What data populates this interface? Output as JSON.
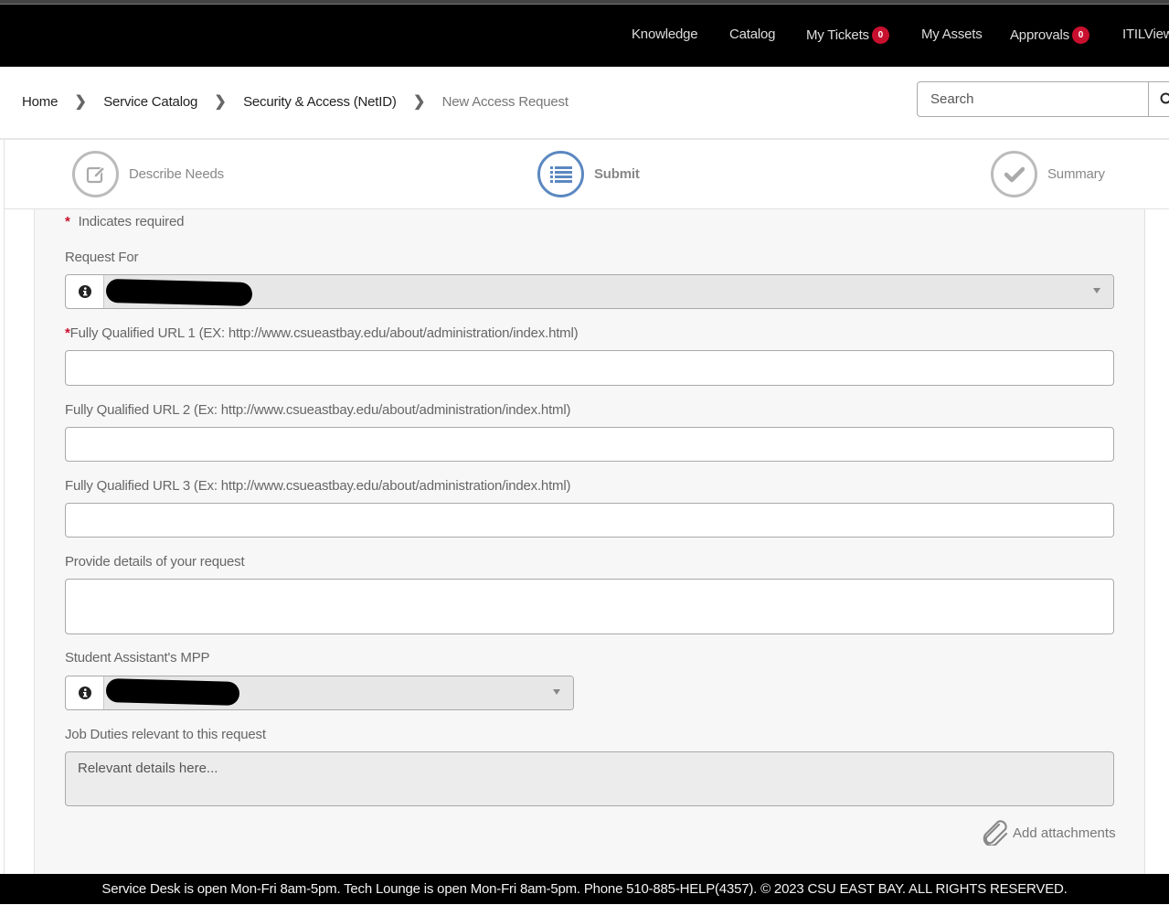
{
  "nav": {
    "items": [
      {
        "label": "Knowledge"
      },
      {
        "label": "Catalog"
      },
      {
        "label": "My Tickets",
        "badge": "0"
      },
      {
        "label": "My Assets"
      },
      {
        "label": "Approvals",
        "badge": "0"
      },
      {
        "label": "ITILView"
      }
    ],
    "badge_color": "#c8102e"
  },
  "breadcrumb": {
    "items": [
      "Home",
      "Service Catalog",
      "Security & Access (NetID)"
    ],
    "current": "New Access Request",
    "separator_icon": "chevron-right-icon"
  },
  "search": {
    "placeholder": "Search",
    "value": "",
    "icon": "search-icon"
  },
  "stepper": {
    "steps": [
      {
        "label": "Describe Needs",
        "icon": "edit-icon",
        "state": "inactive"
      },
      {
        "label": "Submit",
        "icon": "list-icon",
        "state": "active"
      },
      {
        "label": "Summary",
        "icon": "check-icon",
        "state": "inactive"
      }
    ],
    "active_color": "#5b88c0"
  },
  "form": {
    "required_note": "Indicates required",
    "required_marker": "*",
    "request_for": {
      "label": "Request For",
      "value": "[redacted]",
      "icon": "info-icon"
    },
    "url1": {
      "label": "Fully Qualified URL 1 (EX: http://www.csueastbay.edu/about/administration/index.html)",
      "required": true,
      "value": ""
    },
    "url2": {
      "label": "Fully Qualified URL 2 (Ex: http://www.csueastbay.edu/about/administration/index.html)",
      "value": ""
    },
    "url3": {
      "label": "Fully Qualified URL 3 (Ex: http://www.csueastbay.edu/about/administration/index.html)",
      "value": ""
    },
    "details": {
      "label": "Provide details of your request",
      "value": ""
    },
    "mpp": {
      "label": "Student Assistant's MPP",
      "value": "[redacted]",
      "icon": "info-icon"
    },
    "job_duties": {
      "label": "Job Duties relevant to this request",
      "value": "Relevant details here..."
    },
    "attachments_label": "Add attachments"
  },
  "footer": {
    "text": "Service Desk is open Mon-Fri 8am-5pm. Tech Lounge is open Mon-Fri 8am-5pm. Phone 510-885-HELP(4357). © 2023 CSU EAST BAY.  ALL RIGHTS RESERVED."
  }
}
